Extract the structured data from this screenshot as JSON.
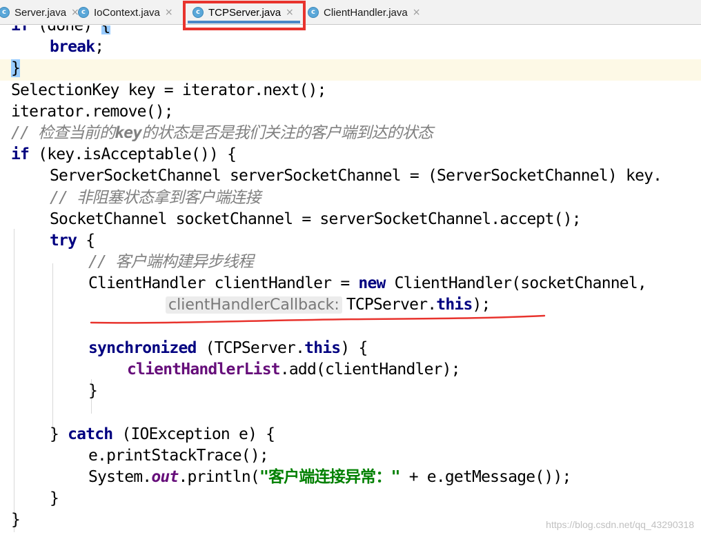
{
  "tabs": [
    {
      "label": "Server.java",
      "icon": "java-class-icon",
      "active": false
    },
    {
      "label": "IoContext.java",
      "icon": "java-class-icon",
      "active": false
    },
    {
      "label": "TCPServer.java",
      "icon": "java-class-icon",
      "active": true
    },
    {
      "label": "ClientHandler.java",
      "icon": "java-class-icon",
      "active": false
    }
  ],
  "tab_icon_letter": "c",
  "tab_close_glyph": "×",
  "code_lines": [
    {
      "indent": 0,
      "tokens": [
        [
          "kw",
          "if"
        ],
        [
          "",
          " (done) "
        ],
        [
          "brace",
          "{"
        ]
      ]
    },
    {
      "indent": 1,
      "tokens": [
        [
          "kw",
          "break"
        ],
        [
          "",
          ";"
        ]
      ]
    },
    {
      "indent": 0,
      "tokens": [
        [
          "brace",
          "}"
        ]
      ]
    },
    {
      "indent": 0,
      "tokens": [
        [
          "",
          "SelectionKey key = iterator.next();"
        ]
      ]
    },
    {
      "indent": 0,
      "tokens": [
        [
          "",
          "iterator.remove();"
        ]
      ]
    },
    {
      "indent": 0,
      "tokens": [
        [
          "cm",
          "// 检查当前的"
        ],
        [
          "cm-bold",
          "key"
        ],
        [
          "cm",
          "的状态是否是我们关注的客户端到达的状态"
        ]
      ]
    },
    {
      "indent": 0,
      "tokens": [
        [
          "kw",
          "if"
        ],
        [
          "",
          " (key.isAcceptable()) {"
        ]
      ]
    },
    {
      "indent": 1,
      "tokens": [
        [
          "",
          "ServerSocketChannel serverSocketChannel = (ServerSocketChannel) key."
        ]
      ]
    },
    {
      "indent": 1,
      "tokens": [
        [
          "cm",
          "// 非阻塞状态拿到客户端连接"
        ]
      ]
    },
    {
      "indent": 1,
      "tokens": [
        [
          "",
          "SocketChannel socketChannel = serverSocketChannel.accept();"
        ]
      ]
    },
    {
      "indent": 1,
      "tokens": [
        [
          "kw",
          "try"
        ],
        [
          "",
          " {"
        ]
      ]
    },
    {
      "indent": 2,
      "tokens": [
        [
          "cm",
          "// 客户端构建异步线程"
        ]
      ]
    },
    {
      "indent": 2,
      "tokens": [
        [
          "",
          "ClientHandler clientHandler = "
        ],
        [
          "kw",
          "new"
        ],
        [
          "",
          " ClientHandler(socketChannel,"
        ]
      ]
    },
    {
      "indent": 4,
      "tokens": [
        [
          "hint",
          "clientHandlerCallback:"
        ],
        [
          "",
          "TCPServer."
        ],
        [
          "kw",
          "this"
        ],
        [
          "",
          ");"
        ]
      ]
    },
    {
      "indent": 0,
      "tokens": []
    },
    {
      "indent": 2,
      "tokens": [
        [
          "kw",
          "synchronized"
        ],
        [
          "",
          " (TCPServer."
        ],
        [
          "kw",
          "this"
        ],
        [
          "",
          ") {"
        ]
      ]
    },
    {
      "indent": 3,
      "tokens": [
        [
          "field",
          "clientHandlerList"
        ],
        [
          "",
          ".add(clientHandler);"
        ]
      ]
    },
    {
      "indent": 2,
      "tokens": [
        [
          "",
          "}"
        ]
      ]
    },
    {
      "indent": 0,
      "tokens": []
    },
    {
      "indent": 1,
      "tokens": [
        [
          "",
          "} "
        ],
        [
          "kw",
          "catch"
        ],
        [
          "",
          " (IOException e) {"
        ]
      ]
    },
    {
      "indent": 2,
      "tokens": [
        [
          "",
          "e.printStackTrace();"
        ]
      ]
    },
    {
      "indent": 2,
      "tokens": [
        [
          "",
          "System."
        ],
        [
          "static",
          "out"
        ],
        [
          "",
          ".println("
        ],
        [
          "str",
          "\"客户端连接异常：\""
        ],
        [
          "",
          " + e.getMessage());"
        ]
      ]
    },
    {
      "indent": 1,
      "tokens": [
        [
          "",
          "}"
        ]
      ]
    },
    {
      "indent": 0,
      "tokens": [
        [
          "",
          "}"
        ]
      ]
    }
  ],
  "watermark": "https://blog.csdn.net/qq_43290318",
  "colors": {
    "keyword": "#000080",
    "comment": "#808080",
    "string": "#008000",
    "field": "#660e7a",
    "current_line": "#fdf9e6",
    "annotation_red": "#e8332d",
    "active_tab_underline": "#4a88c7"
  }
}
